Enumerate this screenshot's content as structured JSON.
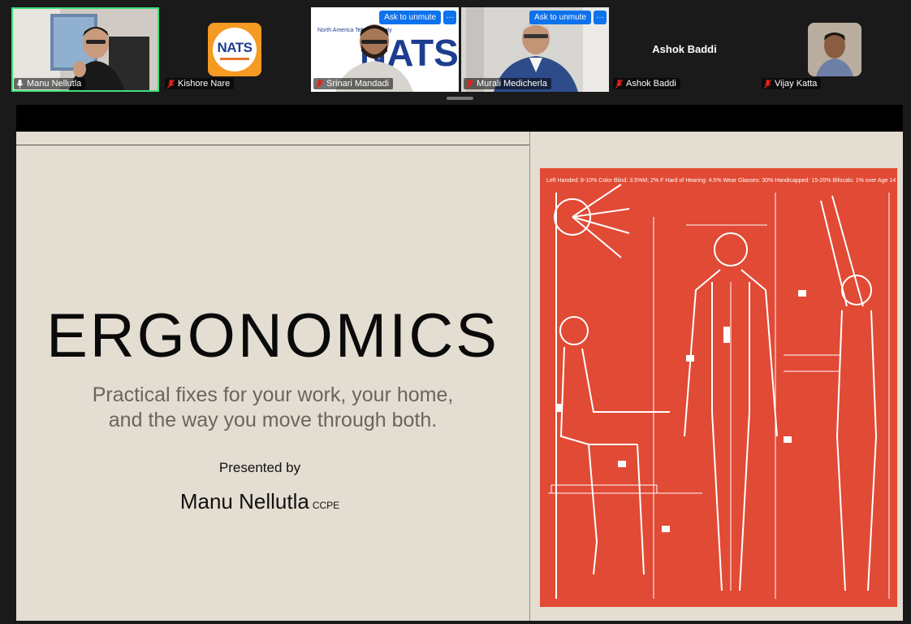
{
  "participants": [
    {
      "name": "Manu Nellutla",
      "muted": false,
      "type": "video"
    },
    {
      "name": "Kishore Nare",
      "muted": true,
      "type": "logo",
      "logo_text": "NATS"
    },
    {
      "name": "Srinari Mandadi",
      "muted": true,
      "type": "video",
      "action": "Ask to unmute",
      "backdrop_text": "NATS",
      "backdrop_caption": "North America Telugu Society"
    },
    {
      "name": "Murali Medicherla",
      "muted": true,
      "type": "video",
      "action": "Ask to unmute"
    },
    {
      "name": "Ashok Baddi",
      "muted": true,
      "type": "name",
      "display_name": "Ashok Baddi"
    },
    {
      "name": "Vijay Katta",
      "muted": true,
      "type": "photo"
    }
  ],
  "more_icon": "···",
  "slide": {
    "title": "ERGONOMICS",
    "subtitle_line1": "Practical fixes for your work, your home,",
    "subtitle_line2": "and the way you move through both.",
    "presented_by": "Presented by",
    "presenter": "Manu Nellutla",
    "credential": "CCPE",
    "diagram_header": "Left Handed: 8-10%   Color Blind: 3.5%M; 2% F   Hard of Hearing: 4.5%   Wear Glasses: 30%   Handicapped: 15-20%   Bifocals: 1% over Age 14"
  },
  "colors": {
    "active_speaker_border": "#3ee07a",
    "unmute_button": "#0e72ed",
    "slide_background": "#e4ddd1",
    "diagram_red": "#e14a34"
  }
}
